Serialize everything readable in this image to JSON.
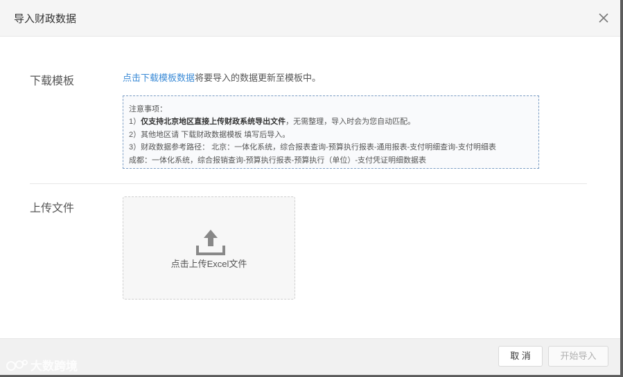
{
  "dialog": {
    "title": "导入财政数据",
    "close_icon": "close-icon"
  },
  "download": {
    "label": "下载模板",
    "link_text": "点击下载模板数据",
    "rest_text": "将要导入的数据更新至模板中。"
  },
  "notice": {
    "heading": "注意事项：",
    "line1_prefix": "1）",
    "line1_bold": "仅支持北京地区直接上传财政系统导出文件",
    "line1_rest": "，无需整理，导入时会为您自动匹配。",
    "line2": "2）其他地区请 下载财政数据模板 填写后导入。",
    "line3": "3）财政数据参考路径：  北京：一体化系统，综合报表查询-预算执行报表-通用报表-支付明细查询-支付明细表",
    "line4": "成都：一体化系统，综合报销查询-预算执行报表-预算执行（单位）-支付凭证明细数据表"
  },
  "upload": {
    "label": "上传文件",
    "icon": "upload-icon",
    "text": "点击上传Excel文件"
  },
  "footer": {
    "cancel_label": "取 消",
    "start_label": "开始导入"
  },
  "watermark": {
    "text": "大数跨境"
  },
  "colors": {
    "link": "#3a8ad6",
    "notice_border": "#7b9dc4"
  }
}
